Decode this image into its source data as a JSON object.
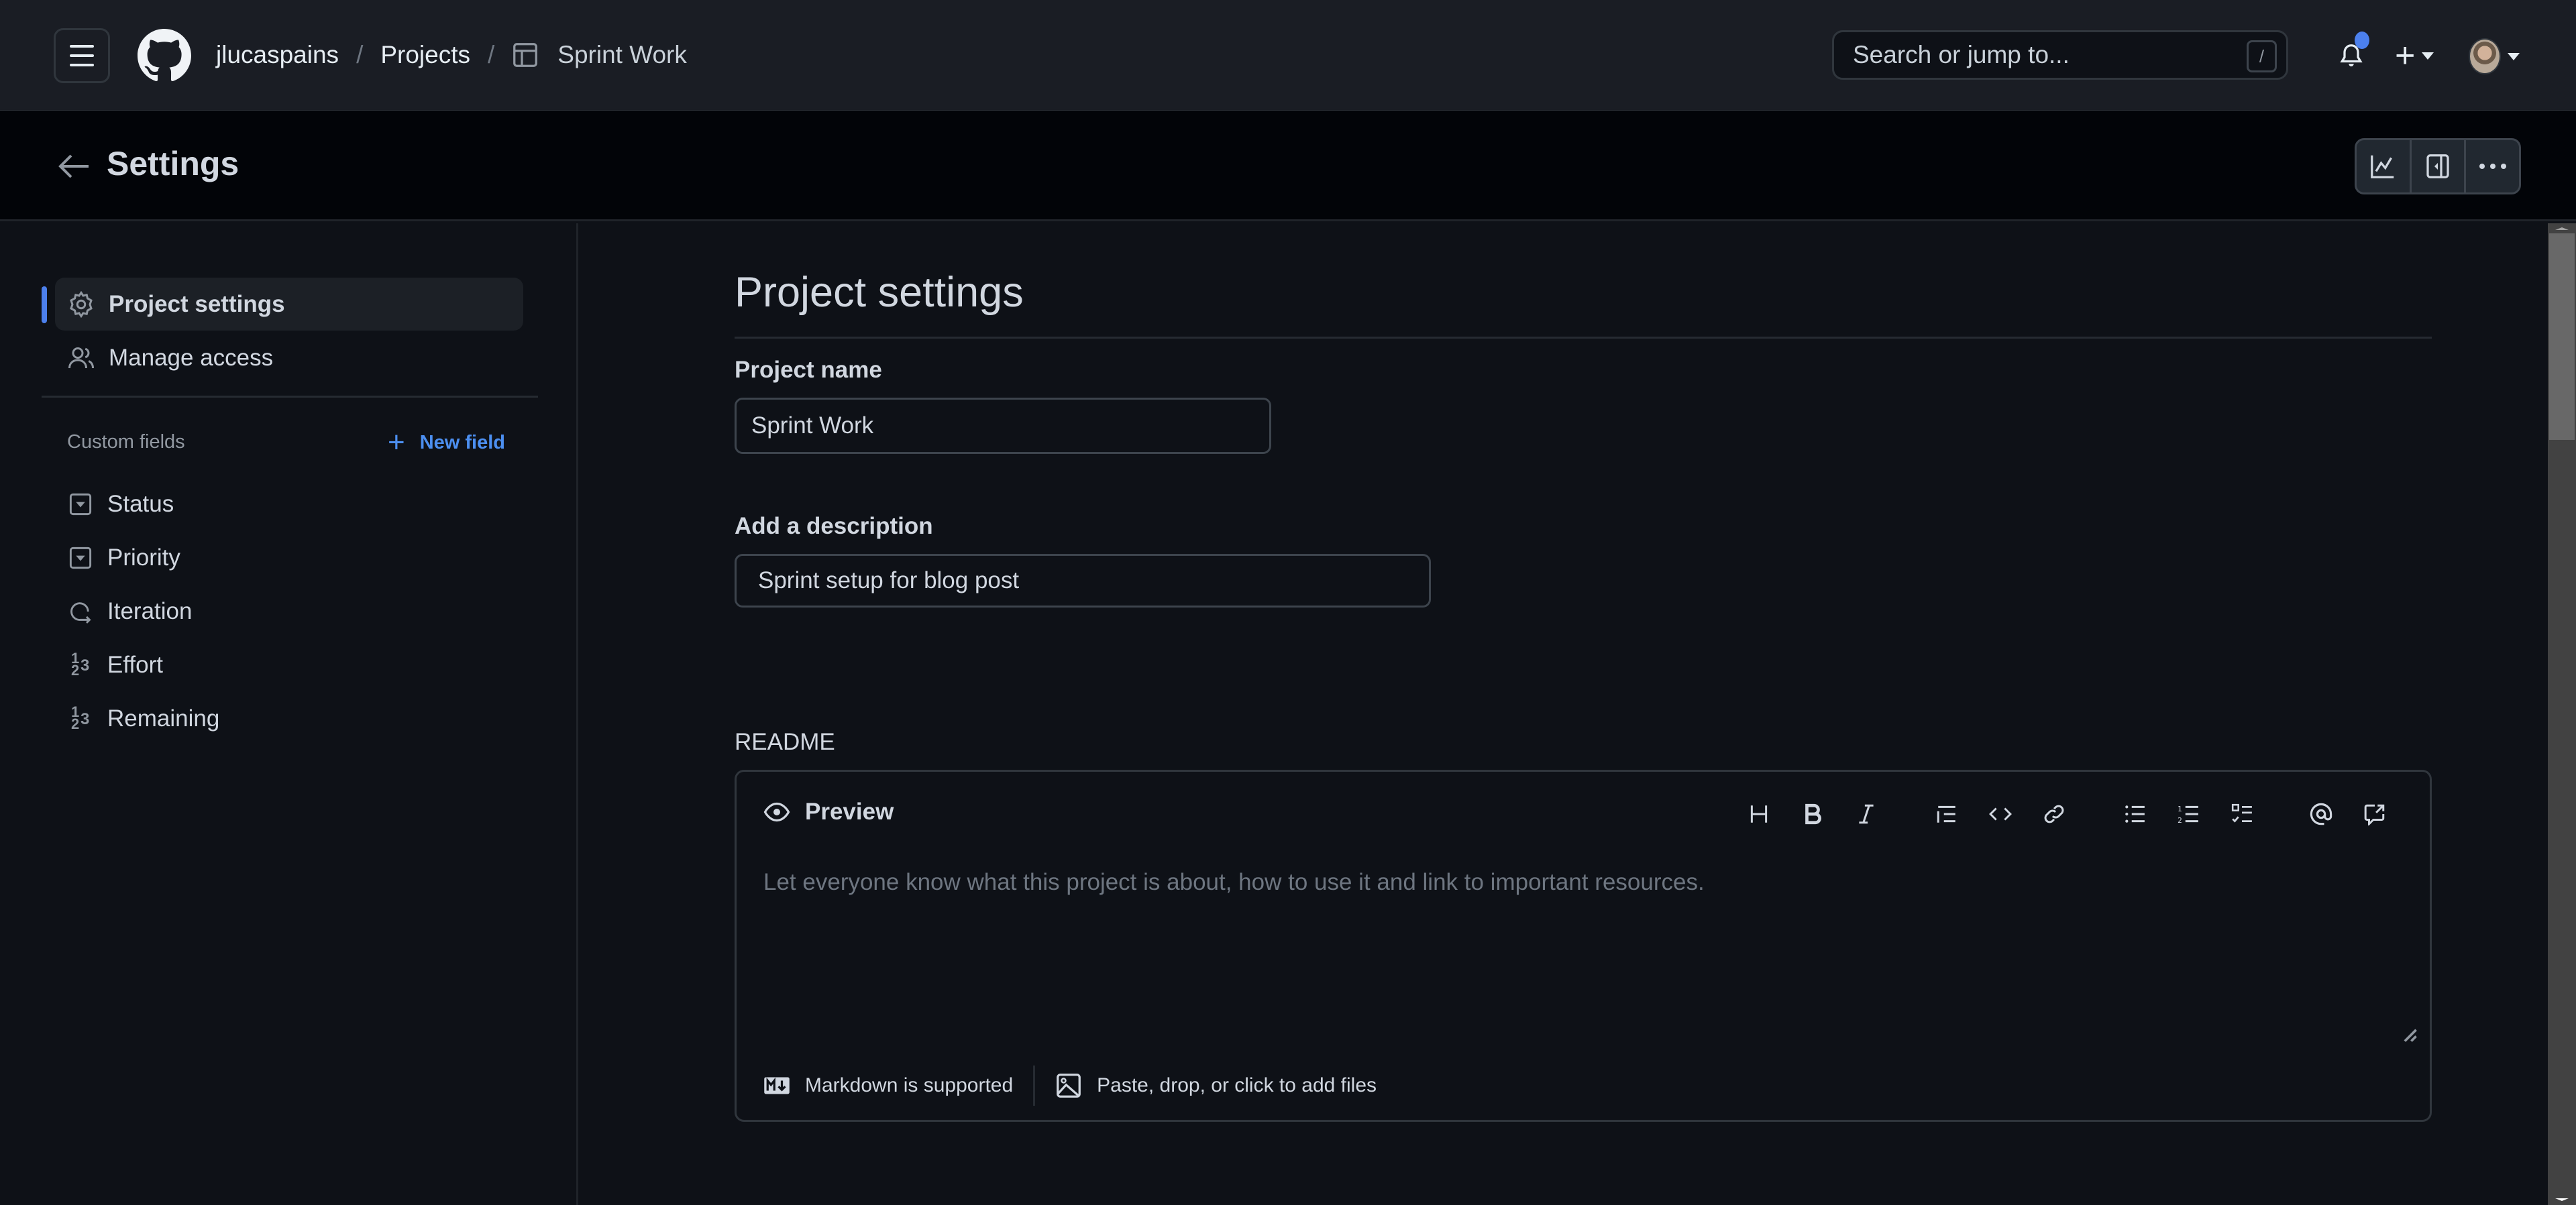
{
  "topnav": {
    "breadcrumb": [
      {
        "label": "jlucaspains"
      },
      {
        "label": "Projects"
      },
      {
        "label": "Sprint Work",
        "icon": "table-icon"
      }
    ],
    "separator": "/",
    "search": {
      "placeholder": "Search or jump to...",
      "shortcut": "/"
    },
    "notification_unread": true,
    "accent_color": "#4c80ed"
  },
  "subheader": {
    "title": "Settings",
    "actions": [
      {
        "name": "insights",
        "icon": "graph-icon"
      },
      {
        "name": "toggle-side-panel",
        "icon": "sidebar-expand-icon"
      },
      {
        "name": "more-options",
        "icon": "kebab-horizontal-icon"
      }
    ]
  },
  "sidebar": {
    "items": [
      {
        "label": "Project settings",
        "icon": "gear-icon",
        "active": true
      },
      {
        "label": "Manage access",
        "icon": "people-icon",
        "active": false
      }
    ],
    "custom_fields_label": "Custom fields",
    "new_field_label": "New field",
    "fields": [
      {
        "label": "Status",
        "icon": "single-select-icon"
      },
      {
        "label": "Priority",
        "icon": "single-select-icon"
      },
      {
        "label": "Iteration",
        "icon": "iterations-icon"
      },
      {
        "label": "Effort",
        "icon": "number-icon"
      },
      {
        "label": "Remaining",
        "icon": "number-icon"
      }
    ]
  },
  "main": {
    "title": "Project settings",
    "project_name_label": "Project name",
    "project_name_value": "Sprint Work",
    "description_label": "Add a description",
    "description_value": "Sprint setup for blog post",
    "readme_label": "README",
    "editor": {
      "preview_label": "Preview",
      "placeholder": "Let everyone know what this project is about, how to use it and link to important resources.",
      "toolbar": [
        "heading",
        "bold",
        "italic",
        "quote",
        "code",
        "link",
        "unordered-list",
        "ordered-list",
        "task-list",
        "mention",
        "reference"
      ],
      "markdown_note": "Markdown is supported",
      "attach_note": "Paste, drop, or click to add files"
    }
  }
}
